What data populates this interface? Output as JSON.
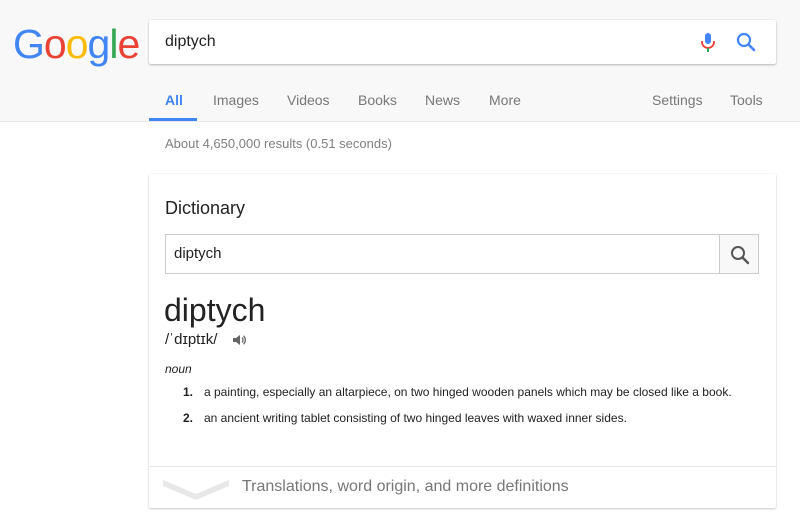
{
  "logo": {
    "letters": [
      "G",
      "o",
      "o",
      "g",
      "l",
      "e"
    ],
    "colors": [
      "#4285f4",
      "#ea4335",
      "#fbbc05",
      "#4285f4",
      "#34a853",
      "#ea4335"
    ]
  },
  "search": {
    "query": "diptych"
  },
  "tabs": [
    {
      "label": "All",
      "active": true
    },
    {
      "label": "Images"
    },
    {
      "label": "Videos"
    },
    {
      "label": "Books"
    },
    {
      "label": "News"
    },
    {
      "label": "More"
    },
    {
      "label": "Settings"
    },
    {
      "label": "Tools"
    }
  ],
  "stats": "About 4,650,000 results (0.51 seconds)",
  "dictionary": {
    "title": "Dictionary",
    "input_value": "diptych",
    "word": "diptych",
    "phonetic": "/ˈdɪptɪk/",
    "part_of_speech": "noun",
    "definitions": [
      {
        "num": "1.",
        "text": "a painting, especially an altarpiece, on two hinged wooden panels which may be closed like a book."
      },
      {
        "num": "2.",
        "text": "an ancient writing tablet consisting of two hinged leaves with waxed inner sides."
      }
    ],
    "more_link": "Translations, word origin, and more definitions"
  },
  "icons": {
    "mic": "mic-icon",
    "search": "search-icon",
    "speaker": "speaker-icon",
    "chevron": "chevron-down-icon"
  }
}
